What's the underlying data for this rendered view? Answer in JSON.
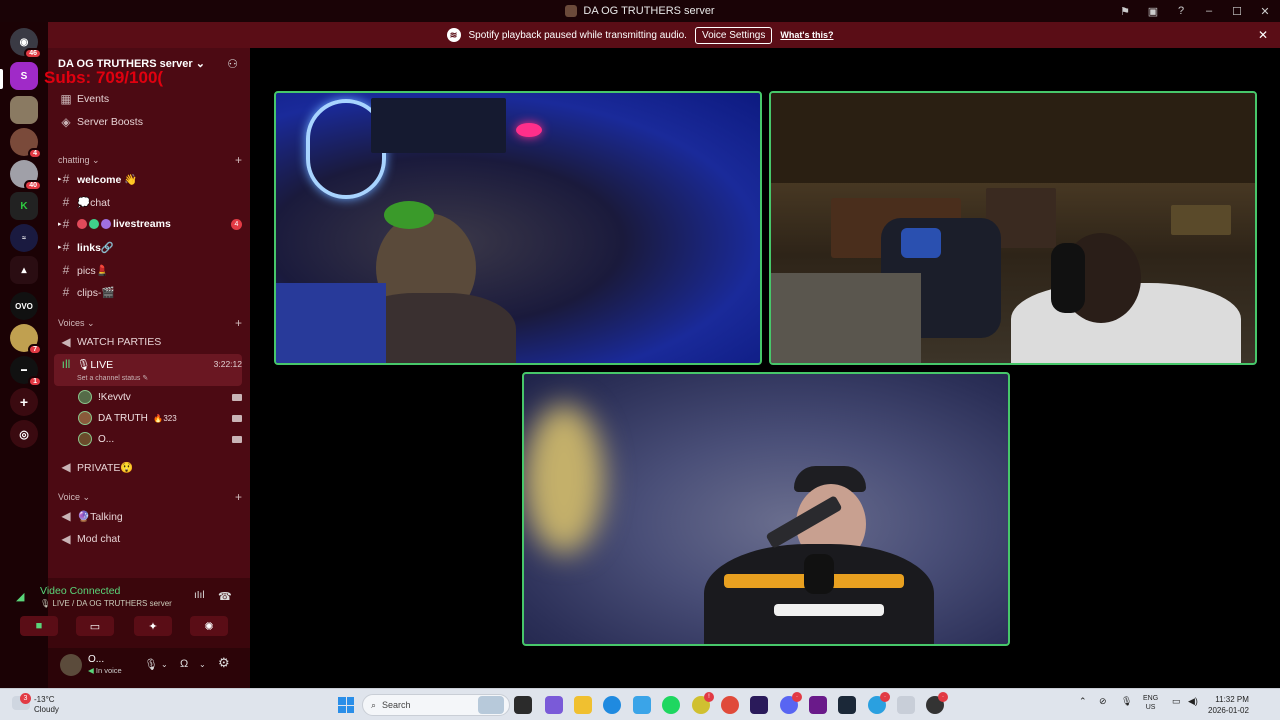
{
  "window": {
    "title": "DA OG TRUTHERS server"
  },
  "notice": {
    "message": "Spotify playback paused while transmitting audio.",
    "voice_settings_label": "Voice Settings",
    "whats_this_label": "What's this?"
  },
  "guilds": [
    {
      "name": "direct-messages",
      "badge": "46"
    },
    {
      "name": "server-2",
      "badge": ""
    },
    {
      "name": "server-3",
      "badge": ""
    },
    {
      "name": "server-4",
      "badge": "4"
    },
    {
      "name": "server-5",
      "badge": "40"
    },
    {
      "name": "server-6",
      "badge": ""
    },
    {
      "name": "server-7",
      "badge": ""
    },
    {
      "name": "server-8",
      "badge": ""
    },
    {
      "name": "server-9",
      "badge": ""
    },
    {
      "name": "server-10",
      "badge": "7"
    },
    {
      "name": "server-11",
      "badge": "1"
    }
  ],
  "sidebar": {
    "server_name": "DA OG TRUTHERS server",
    "subs_overlay": "Subs: 709/100(",
    "events_label": "Events",
    "boosts_label": "Server Boosts",
    "categories": {
      "chatting": "chatting",
      "voices": "Voices",
      "voice": "Voice"
    },
    "channels": {
      "welcome": "welcome 👋",
      "chat": "💭chat",
      "livestreams": "livestreams",
      "livestreams_badge": "4",
      "links": "links🔗",
      "pics": "pics💄",
      "clips": "clips-🎬"
    },
    "voice_channels": {
      "watch_parties": "WATCH PARTIES",
      "live": "🎙LIVE",
      "live_timer": "3:22:12",
      "live_status": "Set a channel status",
      "private": "PRIVATE😲",
      "talking": "🔮Talking",
      "mod_chat": "Mod chat"
    },
    "voice_users": [
      {
        "name": "!Kevvtv",
        "extra": ""
      },
      {
        "name": "DA TRUTH",
        "extra": "🔥323"
      },
      {
        "name": "O...",
        "extra": ""
      }
    ]
  },
  "voice_panel": {
    "status": "Video Connected",
    "location": "LIVE / DA OG TRUTHERS server"
  },
  "account": {
    "name": "O...",
    "status": "In voice"
  },
  "taskbar": {
    "temp": "-13°C",
    "condition": "Cloudy",
    "weather_badge": "3",
    "search_placeholder": "Search",
    "lang": "ENG",
    "region": "US",
    "time": "11:32 PM",
    "date": "2026-01-02"
  },
  "colors": {
    "accent": "#e23a44",
    "sidebar_bg": "#4c0a13",
    "speaking_border": "#47c76a",
    "connected_green": "#5ad67a"
  }
}
